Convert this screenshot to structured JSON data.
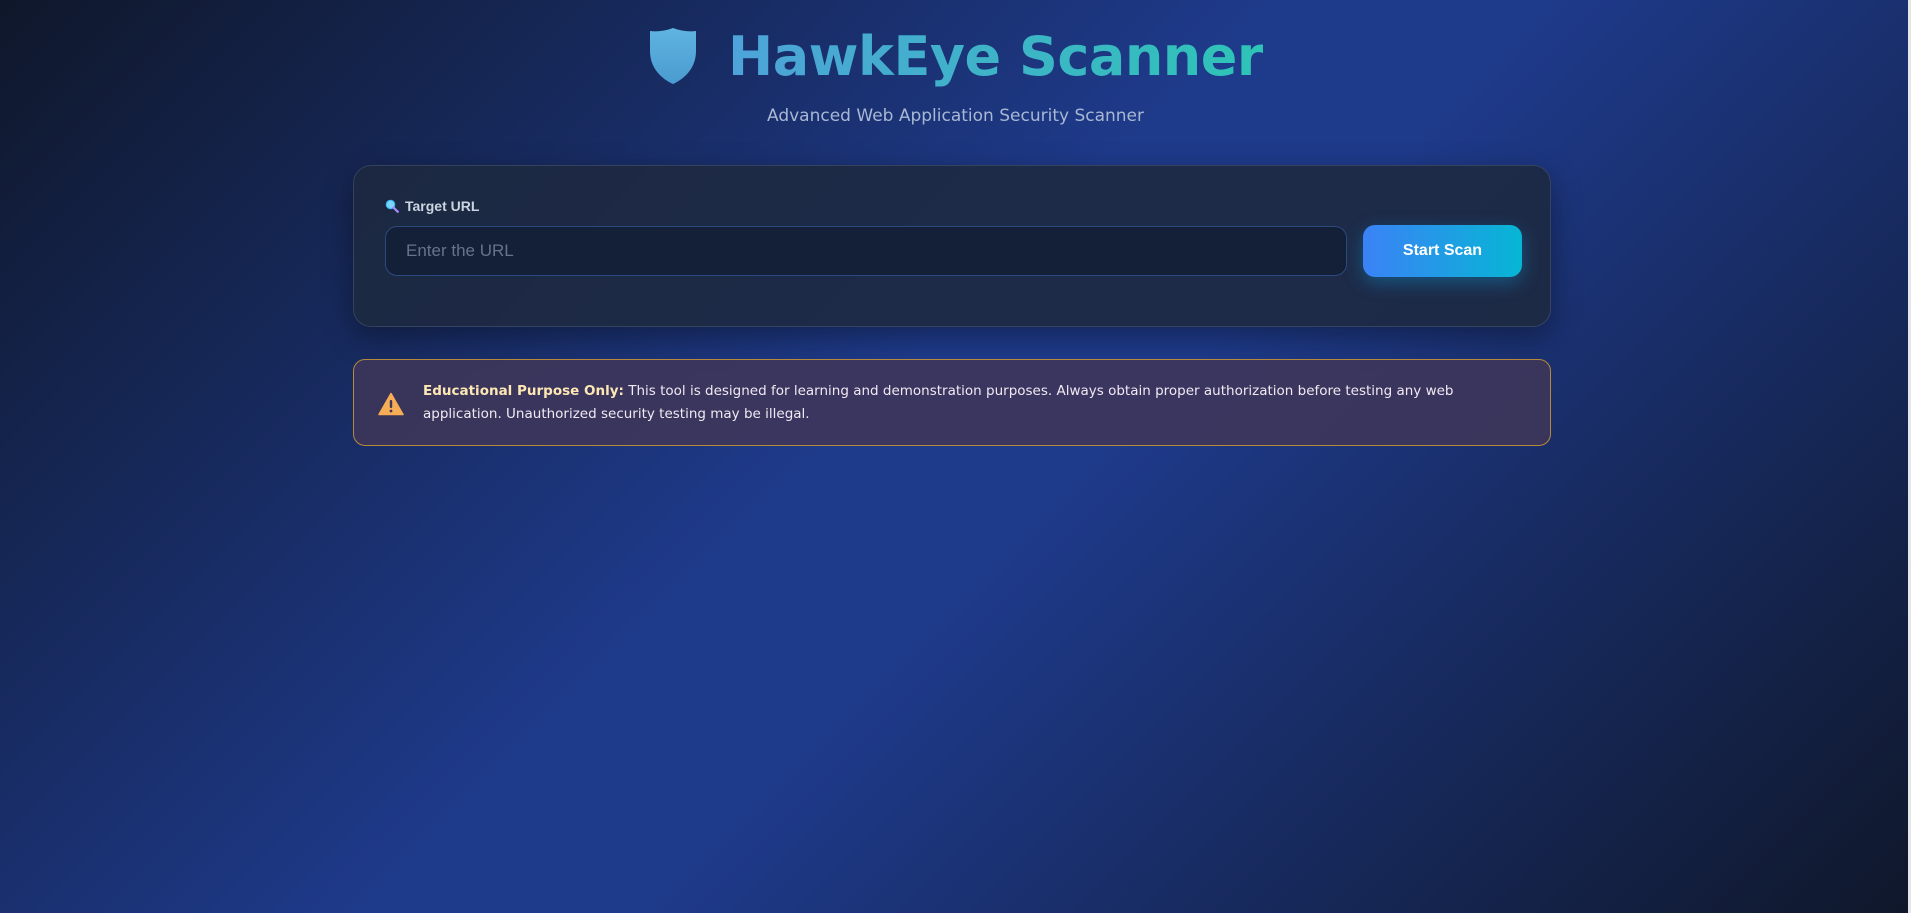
{
  "header": {
    "title": "HawkEye Scanner",
    "subtitle": "Advanced Web Application Security Scanner",
    "logo_icon": "shield-icon"
  },
  "scan_form": {
    "label": "Target URL",
    "label_icon": "magnifier-icon",
    "url_placeholder": "Enter the URL",
    "url_value": "",
    "submit_label": "Start Scan"
  },
  "notice": {
    "icon": "warning-icon",
    "heading": "Educational Purpose Only:",
    "body": " This tool is designed for learning and demonstration purposes. Always obtain proper authorization before testing any web application. Unauthorized security testing may be illegal."
  },
  "colors": {
    "accent_start": "#3b82f6",
    "accent_end": "#06b6d4",
    "title": "#38b2c9",
    "warning_border": "#b7893a",
    "warning_icon": "#f6ad55",
    "background": "#1e3a8a"
  }
}
